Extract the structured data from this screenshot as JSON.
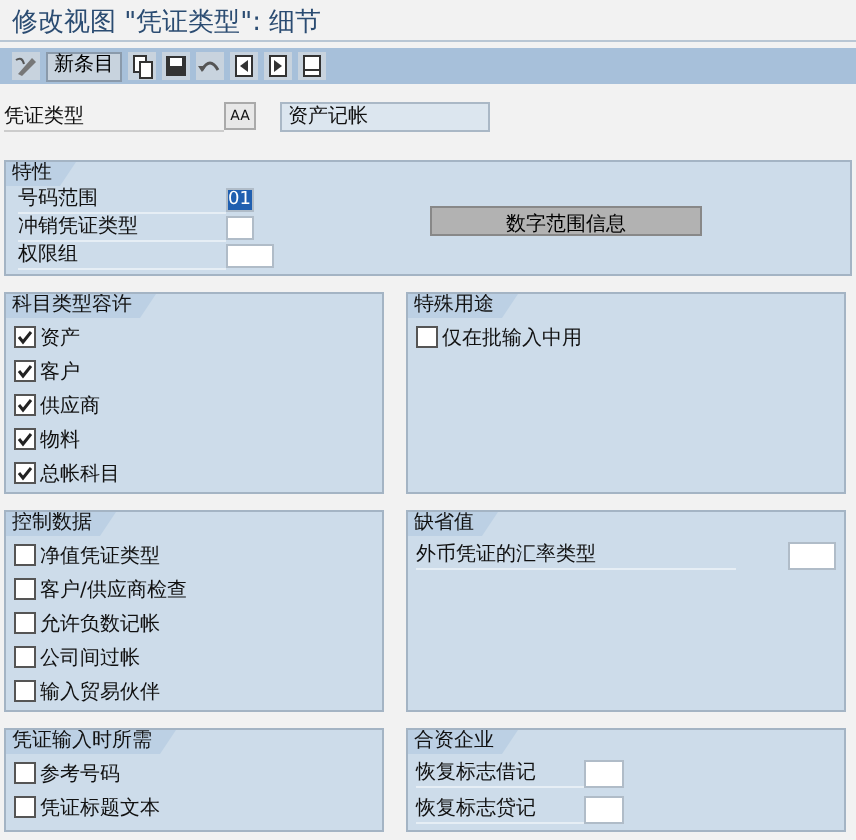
{
  "window": {
    "title": "修改视图 \"凭证类型\": 细节"
  },
  "toolbar": [
    {
      "kind": "pen"
    },
    {
      "kind": "text",
      "label": "新条目"
    },
    {
      "kind": "copy"
    },
    {
      "kind": "save"
    },
    {
      "kind": "undo"
    },
    {
      "kind": "prev"
    },
    {
      "kind": "next"
    },
    {
      "kind": "list"
    }
  ],
  "header": {
    "label": "凭证类型",
    "key": "AA",
    "value": "资产记帐"
  },
  "characteristics": {
    "title": "特性",
    "fields": [
      {
        "label": "号码范围",
        "value": "01",
        "selected": true
      },
      {
        "label": "冲销凭证类型",
        "selected": false
      },
      {
        "label": "权限组",
        "selected": false
      }
    ],
    "button": "数字范围信息"
  },
  "panel_rows": [
    [
      {
        "title": "科目类型容许",
        "items": [
          {
            "kind": "checkbox",
            "label": "资产",
            "checked": true
          },
          {
            "kind": "checkbox",
            "label": "客户",
            "checked": true
          },
          {
            "kind": "checkbox",
            "label": "供应商",
            "checked": true
          },
          {
            "kind": "checkbox",
            "label": "物料",
            "checked": true
          },
          {
            "kind": "checkbox",
            "label": "总帐科目",
            "checked": true
          }
        ]
      },
      {
        "title": "特殊用途",
        "items": [
          {
            "kind": "checkbox",
            "label": "仅在批输入中用",
            "checked": false
          }
        ]
      }
    ],
    [
      {
        "title": "控制数据",
        "items": [
          {
            "kind": "checkbox",
            "label": "净值凭证类型",
            "checked": false
          },
          {
            "kind": "checkbox",
            "label": "客户/供应商检查",
            "checked": false
          },
          {
            "kind": "checkbox",
            "label": "允许负数记帐",
            "checked": false
          },
          {
            "kind": "checkbox",
            "label": "公司间过帐",
            "checked": false
          },
          {
            "kind": "checkbox",
            "label": "输入贸易伙伴",
            "checked": false
          }
        ]
      },
      {
        "title": "缺省值",
        "items": [
          {
            "kind": "field",
            "label": "外币凭证的汇率类型"
          }
        ]
      }
    ],
    [
      {
        "title": "凭证输入时所需",
        "items": [
          {
            "kind": "checkbox",
            "label": "参考号码",
            "checked": false
          },
          {
            "kind": "checkbox",
            "label": "凭证标题文本",
            "checked": false
          }
        ]
      },
      {
        "title": "合资企业",
        "items": [
          {
            "kind": "field",
            "label": "恢复标志借记"
          },
          {
            "kind": "field",
            "label": "恢复标志贷记"
          }
        ]
      }
    ]
  ]
}
